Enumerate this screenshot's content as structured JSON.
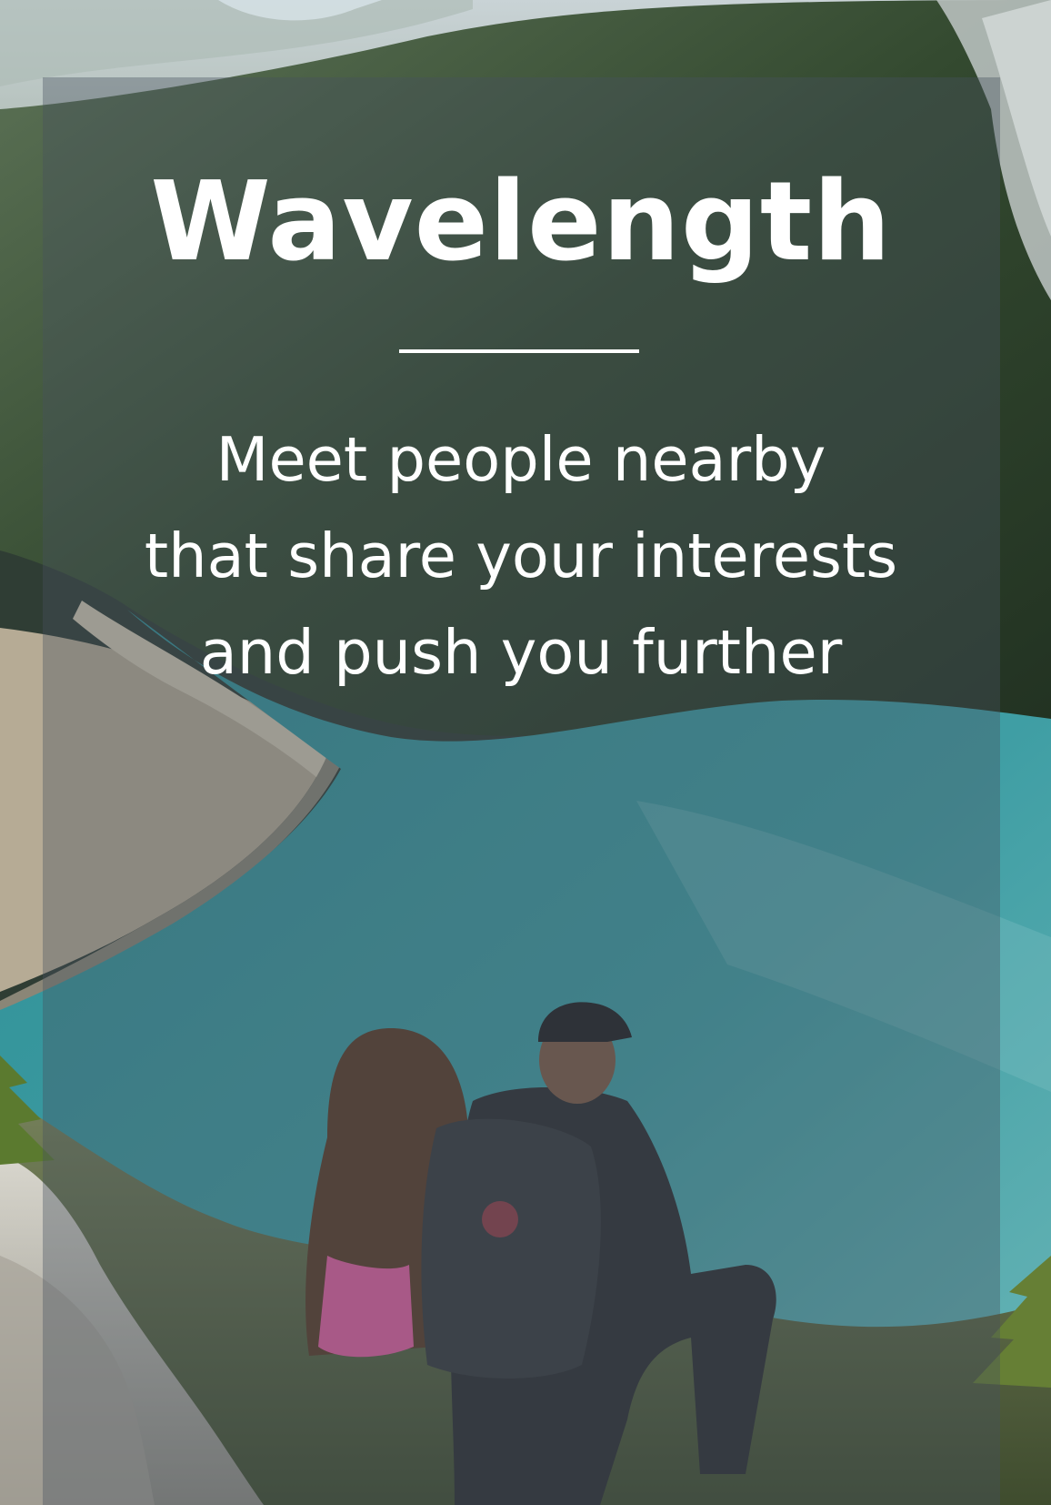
{
  "colors": {
    "overlay": "#48525f",
    "text": "#ffffff",
    "lake": "#3b9aa0",
    "forest": "#2f4a35"
  },
  "hero": {
    "title": "Wavelength",
    "tagline": [
      "Meet people nearby",
      "that share your interests",
      "and push you further"
    ],
    "background_image": "mountain-lake-hikers-photo"
  }
}
